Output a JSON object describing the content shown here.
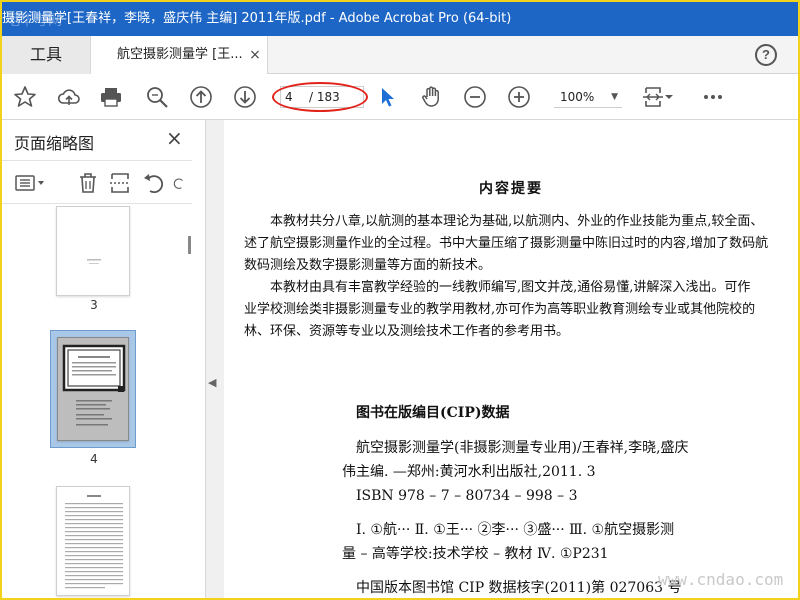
{
  "window": {
    "title": "摄影测量学[王春祥，李晓，盛庆伟 主编] 2011年版.pdf - Adobe Acrobat Pro (64-bit)",
    "watermark_top": "毛华考网"
  },
  "tabs": {
    "tools_label": "工具",
    "doc_label": "航空摄影测量学 [王...",
    "close_symbol": "×",
    "help_symbol": "?"
  },
  "toolbar": {
    "icons": [
      "star-icon",
      "cloud-upload-icon",
      "print-icon",
      "zoom-search-icon",
      "page-up-icon",
      "page-down-icon",
      "select-arrow-icon",
      "hand-icon",
      "zoom-out-icon",
      "zoom-in-icon",
      "fit-page-icon",
      "more-icon"
    ],
    "current_page": "4",
    "total_pages": "/ 183",
    "zoom_value": "100%",
    "highlight_color": "#e2231a"
  },
  "sidebar": {
    "title": "页面缩略图",
    "close_symbol": "×",
    "thumbnails": [
      {
        "label": "3"
      },
      {
        "label": "4",
        "selected": true
      }
    ],
    "selected_color": "#a9c7e6"
  },
  "document": {
    "heading": "内容提要",
    "paragraphs": [
      "本教材共分八章,以航测的基本理论为基础,以航测内、外业的作业技能为重点,较全面、",
      "述了航空摄影测量作业的全过程。书中大量压缩了摄影测量中陈旧过时的内容,增加了数码航",
      "数码测绘及数字摄影测量等方面的新技术。",
      "本教材由具有丰富教学经验的一线教师编写,图文并茂,通俗易懂,讲解深入浅出。可作",
      "业学校测绘类非摄影测量专业的教学用教材,亦可作为高等职业教育测绘专业或其他院校的",
      "林、环保、资源等专业以及测绘技术工作者的参考用书。"
    ],
    "cip_heading": "图书在版编目(CIP)数据",
    "cip_lines": [
      "航空摄影测量学(非摄影测量专业用)/王春祥,李晓,盛庆",
      "伟主编. —郑州:黄河水利出版社,2011. 3",
      " ISBN  978 – 7 – 80734 – 998 – 3",
      "",
      "  Ⅰ. ①航···   Ⅱ. ①王··· ②李··· ③盛···   Ⅲ. ①航空摄影测",
      "量 – 高等学校:技术学校 – 教材   Ⅳ. ①P231",
      "",
      "中国版本图书馆 CIP 数据核字(2011)第 027063 号"
    ],
    "watermark": "www.cndao.com"
  }
}
